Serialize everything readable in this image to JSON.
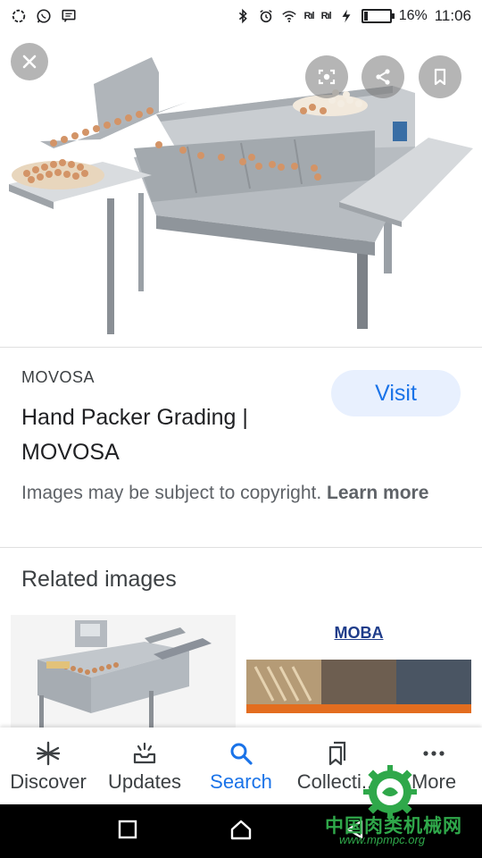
{
  "status_bar": {
    "battery_percent_text": "16%",
    "battery_level": 0.16,
    "time": "11:06",
    "signal_label_1": "R",
    "signal_label_2": "R"
  },
  "image_viewer": {
    "close_icon": "close-icon",
    "lens_icon": "lens-icon",
    "share_icon": "share-icon",
    "bookmark_icon": "bookmark-icon"
  },
  "result": {
    "site": "MOVOSA",
    "title": "Hand Packer Grading | MOVOSA",
    "visit_label": "Visit",
    "copyright_text": "Images may be subject to copyright.",
    "learn_more": "Learn more"
  },
  "related": {
    "heading": "Related images",
    "thumb2_logo": "MOBA"
  },
  "bottom_nav": {
    "items": [
      {
        "label": "Discover",
        "icon": "asterisk-icon"
      },
      {
        "label": "Updates",
        "icon": "updates-icon"
      },
      {
        "label": "Search",
        "icon": "search-icon"
      },
      {
        "label": "Collecti...",
        "icon": "collections-icon"
      },
      {
        "label": "More",
        "icon": "more-dots-icon"
      }
    ],
    "active": "Search"
  },
  "watermark": {
    "text": "中国肉类机械网",
    "url": "www.mpmpc.org"
  },
  "colors": {
    "accent": "#1a73e8",
    "visit_bg": "#e8f0fe",
    "watermark_green": "#2fa84a"
  }
}
